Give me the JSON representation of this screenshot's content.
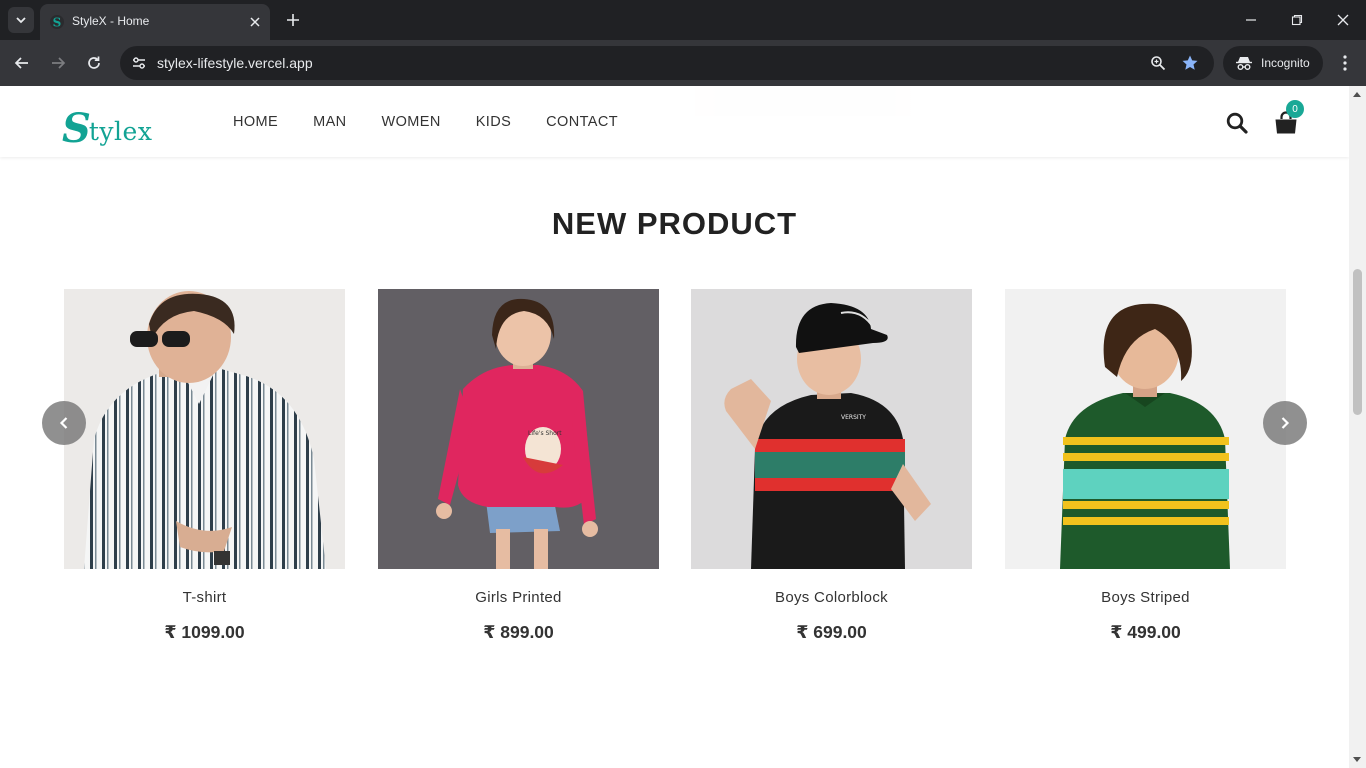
{
  "browser": {
    "tab_title": "StyleX - Home",
    "url": "stylex-lifestyle.vercel.app",
    "incognito_label": "Incognito"
  },
  "site": {
    "logo_initial": "S",
    "logo_rest": "tylex",
    "nav": [
      "HOME",
      "MAN",
      "WOMEN",
      "KIDS",
      "CONTACT"
    ],
    "cart_count": "0"
  },
  "section": {
    "title": "NEW PRODUCT"
  },
  "products": [
    {
      "name": "T-shirt",
      "price": "₹ 1099.00"
    },
    {
      "name": "Girls Printed",
      "price": "₹ 899.00"
    },
    {
      "name": "Boys Colorblock",
      "price": "₹ 699.00"
    },
    {
      "name": "Boys Striped",
      "price": "₹ 499.00"
    }
  ],
  "colors": {
    "brand": "#12a394",
    "badge": "#19a896"
  }
}
